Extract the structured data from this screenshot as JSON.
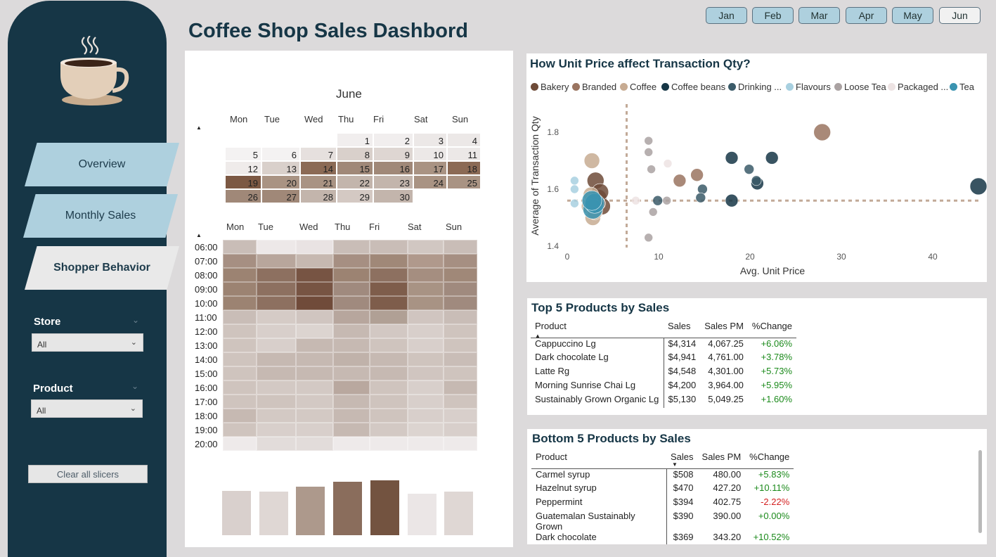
{
  "title": "Coffee Shop Sales Dashbord",
  "nav": [
    {
      "label": "Overview",
      "active": false
    },
    {
      "label": "Monthly Sales",
      "active": false
    },
    {
      "label": "Shopper Behavior",
      "active": true
    }
  ],
  "slicers": {
    "store": {
      "label": "Store",
      "value": "All"
    },
    "product": {
      "label": "Product",
      "value": "All"
    },
    "clear_label": "Clear all slicers"
  },
  "months": [
    {
      "label": "Jan",
      "selected": false
    },
    {
      "label": "Feb",
      "selected": false
    },
    {
      "label": "Mar",
      "selected": false
    },
    {
      "label": "Apr",
      "selected": false
    },
    {
      "label": "May",
      "selected": false
    },
    {
      "label": "Jun",
      "selected": true
    }
  ],
  "calendar": {
    "month": "June",
    "day_labels": [
      "Mon",
      "Tue",
      "Wed",
      "Thu",
      "Fri",
      "Sat",
      "Sun"
    ],
    "weeks": [
      [
        null,
        null,
        null,
        1,
        2,
        3,
        4
      ],
      [
        5,
        6,
        7,
        8,
        9,
        10,
        11
      ],
      [
        12,
        13,
        14,
        15,
        16,
        17,
        18
      ],
      [
        19,
        20,
        21,
        22,
        23,
        24,
        25
      ],
      [
        26,
        27,
        28,
        29,
        30,
        null,
        null
      ]
    ],
    "colors": [
      [
        null,
        null,
        null,
        "#f1eeee",
        "#f1eeee",
        "#ece8e7",
        "#ece8e7"
      ],
      [
        "#f4f2f2",
        "#f4f2f2",
        "#e6e0de",
        "#d9d0cb",
        "#ded6d2",
        "#ece8e7",
        "#ece8e7"
      ],
      [
        "#efebea",
        "#d9d0cb",
        "#8b6a55",
        "#a08878",
        "#a08878",
        "#a99383",
        "#8b6a55"
      ],
      [
        "#7c5843",
        "#a99383",
        "#a99383",
        "#c3b5ac",
        "#c3b5ac",
        "#a99383",
        "#a99383"
      ],
      [
        "#a08878",
        "#a08878",
        "#c3b5ac",
        "#d4c9c3",
        "#c3b5ac",
        null,
        null
      ]
    ]
  },
  "heatmap": {
    "day_labels": [
      "Mon",
      "Tue",
      "Wed",
      "Thu",
      "Fri",
      "Sat",
      "Sun"
    ],
    "hours": [
      "06:00",
      "07:00",
      "08:00",
      "09:00",
      "10:00",
      "11:00",
      "12:00",
      "13:00",
      "14:00",
      "15:00",
      "16:00",
      "17:00",
      "18:00",
      "19:00",
      "20:00"
    ],
    "colors": [
      [
        "#c9bdb7",
        "#ede8e8",
        "#e9e3e3",
        "#c9bdb7",
        "#c9bdb7",
        "#d1c7c2",
        "#c9bdb7"
      ],
      [
        "#a68f82",
        "#b8a69c",
        "#c6b8b0",
        "#a68f82",
        "#a08878",
        "#b0998c",
        "#a68f82"
      ],
      [
        "#9c8372",
        "#8d7060",
        "#775443",
        "#9c8372",
        "#8d7060",
        "#a58e80",
        "#a08878"
      ],
      [
        "#9c8372",
        "#8d7060",
        "#775443",
        "#a08a7e",
        "#7e5d4b",
        "#a89384",
        "#a08a7e"
      ],
      [
        "#9c8372",
        "#8d7060",
        "#704b3a",
        "#a08a7e",
        "#7e5d4b",
        "#a89384",
        "#a08a7e"
      ],
      [
        "#c9bdb7",
        "#d5cbc6",
        "#d0c5c0",
        "#b7a69d",
        "#b0a095",
        "#d0c5c0",
        "#c9bdb7"
      ],
      [
        "#cfc4be",
        "#d8cfcb",
        "#dcd4d0",
        "#c6b9b2",
        "#d2c8c3",
        "#d8cfcb",
        "#cfc4be"
      ],
      [
        "#cfc4be",
        "#d8cfcb",
        "#c6b9b2",
        "#c6b9b2",
        "#cfc4be",
        "#d8cfcb",
        "#cfc4be"
      ],
      [
        "#cfc4be",
        "#c6b9b2",
        "#c6b9b2",
        "#c0b2aa",
        "#c6b9b2",
        "#cfc4be",
        "#c9bdb7"
      ],
      [
        "#cfc4be",
        "#c6b9b2",
        "#c6b9b2",
        "#c6b9b2",
        "#c6b9b2",
        "#d0c5c0",
        "#cfc4be"
      ],
      [
        "#cfc4be",
        "#d3c9c4",
        "#d3c9c4",
        "#b9a89f",
        "#cfc4be",
        "#d8cfcb",
        "#c6b9b2"
      ],
      [
        "#cfc4be",
        "#cfc4be",
        "#d3c9c4",
        "#c6b9b2",
        "#cfc4be",
        "#d8cfcb",
        "#cfc4be"
      ],
      [
        "#c6b9b2",
        "#d3c9c4",
        "#d3c9c4",
        "#c6b9b2",
        "#cfc4be",
        "#d8cfcb",
        "#d8cfcb"
      ],
      [
        "#cfc4be",
        "#d8cfcb",
        "#d8cfcb",
        "#c6b9b2",
        "#d3c9c4",
        "#dcd4d0",
        "#d8cfcb"
      ],
      [
        "#eeeaea",
        "#e2dcda",
        "#e2dcda",
        "#eeeaea",
        "#eeeaea",
        "#eeeaea",
        "#eeeaea"
      ]
    ],
    "bar_values": [
      0.81,
      0.79,
      0.88,
      0.98,
      1.0,
      0.76,
      0.8
    ],
    "bar_colors": [
      "#d9d0cd",
      "#dfd7d4",
      "#ad998c",
      "#8a6d5c",
      "#735340",
      "#ebe6e6",
      "#dfd7d4"
    ]
  },
  "scatter": {
    "title": "How Unit Price affect Transaction Qty?",
    "legend": [
      {
        "name": "Bakery",
        "color": "#6e4b38"
      },
      {
        "name": "Branded",
        "color": "#9a7460"
      },
      {
        "name": "Coffee",
        "color": "#c7ab92"
      },
      {
        "name": "Coffee beans",
        "color": "#163646"
      },
      {
        "name": "Drinking ...",
        "color": "#3b5b69"
      },
      {
        "name": "Flavours",
        "color": "#a8d0e0"
      },
      {
        "name": "Loose Tea",
        "color": "#aaa2a2"
      },
      {
        "name": "Packaged ...",
        "color": "#ede3e3"
      },
      {
        "name": "Tea",
        "color": "#3a93b0"
      }
    ],
    "xlabel": "Avg. Unit Price",
    "ylabel": "Average of Transaction Qty",
    "x_ticks": [
      "0",
      "10",
      "20",
      "30",
      "40"
    ],
    "y_ticks": [
      "1.4",
      "1.6",
      "1.8"
    ]
  },
  "chart_data": {
    "type": "scatter",
    "title": "How Unit Price affect Transaction Qty?",
    "xlabel": "Avg. Unit Price",
    "ylabel": "Average of Transaction Qty",
    "xlim": [
      0,
      45
    ],
    "ylim": [
      1.4,
      1.85
    ],
    "x_ticks": [
      0,
      10,
      20,
      30,
      40
    ],
    "y_ticks": [
      1.4,
      1.6,
      1.8
    ],
    "reference_lines": {
      "x": 6.5,
      "y": 1.56
    },
    "series": [
      {
        "name": "Bakery",
        "color": "#6e4b38",
        "points": [
          [
            3.1,
            1.63
          ],
          [
            3.4,
            1.57
          ],
          [
            3.8,
            1.54
          ],
          [
            3.6,
            1.59
          ]
        ]
      },
      {
        "name": "Branded",
        "color": "#9a7460",
        "points": [
          [
            14.2,
            1.65
          ],
          [
            12.3,
            1.63
          ],
          [
            27.9,
            1.8
          ],
          [
            3.5,
            1.55
          ]
        ]
      },
      {
        "name": "Coffee",
        "color": "#c7ab92",
        "points": [
          [
            2.7,
            1.7
          ],
          [
            2.6,
            1.58
          ],
          [
            2.4,
            1.54
          ],
          [
            2.8,
            1.5
          ],
          [
            3.0,
            1.52
          ]
        ]
      },
      {
        "name": "Coffee beans",
        "color": "#163646",
        "points": [
          [
            18.0,
            1.71
          ],
          [
            22.4,
            1.71
          ],
          [
            20.8,
            1.62
          ],
          [
            45.0,
            1.61
          ],
          [
            18.0,
            1.56
          ]
        ]
      },
      {
        "name": "Drinking ...",
        "color": "#3b5b69",
        "points": [
          [
            19.9,
            1.67
          ],
          [
            20.7,
            1.63
          ],
          [
            14.8,
            1.6
          ],
          [
            14.6,
            1.57
          ],
          [
            9.9,
            1.56
          ]
        ]
      },
      {
        "name": "Flavours",
        "color": "#a8d0e0",
        "points": [
          [
            0.8,
            1.63
          ],
          [
            0.8,
            1.6
          ],
          [
            0.8,
            1.55
          ]
        ]
      },
      {
        "name": "Loose Tea",
        "color": "#aaa2a2",
        "points": [
          [
            8.9,
            1.77
          ],
          [
            8.9,
            1.73
          ],
          [
            9.2,
            1.67
          ],
          [
            9.4,
            1.52
          ],
          [
            8.9,
            1.43
          ],
          [
            10.9,
            1.56
          ]
        ]
      },
      {
        "name": "Packaged ...",
        "color": "#ede3e3",
        "points": [
          [
            11.0,
            1.69
          ],
          [
            7.5,
            1.56
          ]
        ]
      },
      {
        "name": "Tea",
        "color": "#3a93b0",
        "points": [
          [
            2.8,
            1.53
          ],
          [
            3.0,
            1.55
          ],
          [
            2.7,
            1.56
          ]
        ]
      }
    ]
  },
  "top5": {
    "title": "Top 5 Products by Sales",
    "columns": [
      "Product",
      "Sales",
      "Sales PM",
      "%Change"
    ],
    "rows": [
      {
        "product": "Cappuccino Lg",
        "sales": "$4,314",
        "sales_pm": "4,067.25",
        "change": "+6.06%",
        "dir": "pos"
      },
      {
        "product": "Dark chocolate Lg",
        "sales": "$4,941",
        "sales_pm": "4,761.00",
        "change": "+3.78%",
        "dir": "pos"
      },
      {
        "product": "Latte Rg",
        "sales": "$4,548",
        "sales_pm": "4,301.00",
        "change": "+5.73%",
        "dir": "pos"
      },
      {
        "product": "Morning Sunrise Chai Lg",
        "sales": "$4,200",
        "sales_pm": "3,964.00",
        "change": "+5.95%",
        "dir": "pos"
      },
      {
        "product": "Sustainably Grown Organic Lg",
        "sales": "$5,130",
        "sales_pm": "5,049.25",
        "change": "+1.60%",
        "dir": "pos"
      }
    ]
  },
  "bottom5": {
    "title": "Bottom 5 Products by Sales",
    "columns": [
      "Product",
      "Sales",
      "Sales PM",
      "%Change"
    ],
    "rows": [
      {
        "product": "Carmel syrup",
        "sales": "$508",
        "sales_pm": "480.00",
        "change": "+5.83%",
        "dir": "pos"
      },
      {
        "product": "Hazelnut syrup",
        "sales": "$470",
        "sales_pm": "427.20",
        "change": "+10.11%",
        "dir": "pos"
      },
      {
        "product": "Peppermint",
        "sales": "$394",
        "sales_pm": "402.75",
        "change": "-2.22%",
        "dir": "neg"
      },
      {
        "product": "Guatemalan Sustainably Grown",
        "sales": "$390",
        "sales_pm": "390.00",
        "change": "+0.00%",
        "dir": "pos"
      },
      {
        "product": "Dark chocolate",
        "sales": "$369",
        "sales_pm": "343.20",
        "change": "+10.52%",
        "dir": "pos"
      }
    ]
  }
}
